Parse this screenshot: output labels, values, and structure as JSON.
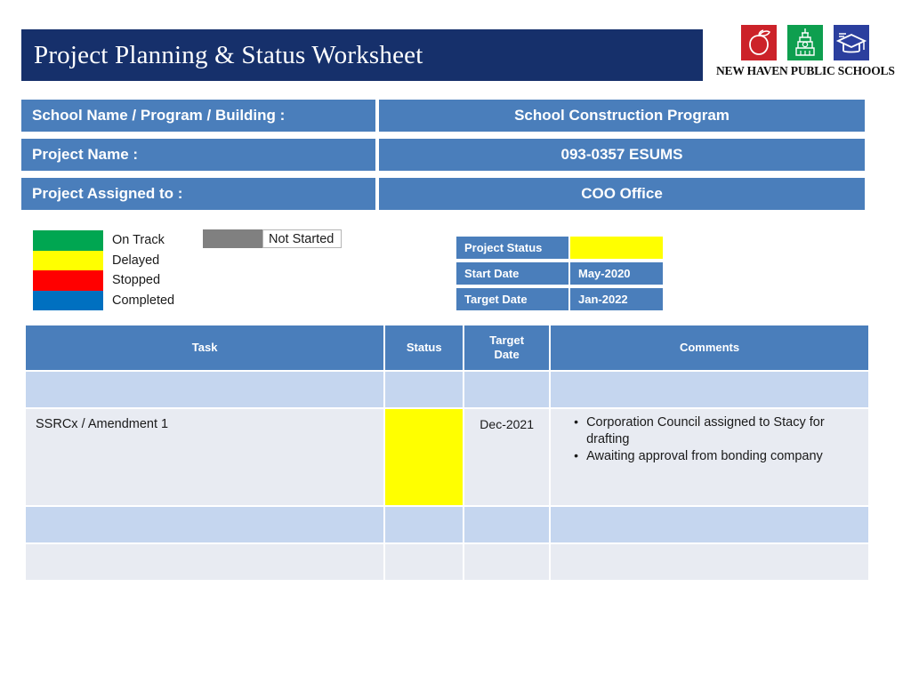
{
  "header": {
    "title": "Project Planning & Status Worksheet",
    "logo": {
      "name": "new-haven-public-schools-logo",
      "wordmark": "NEW HAVEN PUBLIC SCHOOLS",
      "marks": [
        {
          "icon": "apple-icon",
          "color": "#cc2229"
        },
        {
          "icon": "tower-icon",
          "color": "#0e9f4f"
        },
        {
          "icon": "graduation-cap-icon",
          "color": "#2b3f9e"
        }
      ]
    }
  },
  "info_rows": [
    {
      "label": "School Name / Program / Building :",
      "value": "School Construction Program"
    },
    {
      "label": "Project Name :",
      "value": "093-0357 ESUMS"
    },
    {
      "label": "Project Assigned to :",
      "value": "COO Office"
    }
  ],
  "legend": {
    "items": [
      {
        "label": "On Track",
        "color": "#00a651"
      },
      {
        "label": "Delayed",
        "color": "#ffff00"
      },
      {
        "label": "Stopped",
        "color": "#ff0000"
      },
      {
        "label": "Completed",
        "color": "#0070c0"
      }
    ],
    "not_started": {
      "label": "Not Started",
      "color": "#808080"
    }
  },
  "status_panel": {
    "rows": [
      {
        "key": "Project Status",
        "value": "",
        "highlight": "#ffff00"
      },
      {
        "key": "Start Date",
        "value": "May-2020",
        "highlight": ""
      },
      {
        "key": "Target  Date",
        "value": "Jan-2022",
        "highlight": ""
      }
    ]
  },
  "task_table": {
    "columns": [
      "Task",
      "Status",
      "Target\nDate",
      "Comments"
    ],
    "column_labels": {
      "task": "Task",
      "status": "Status",
      "target_date_line1": "Target",
      "target_date_line2": "Date",
      "comments": "Comments"
    },
    "rows": [
      {
        "task": "",
        "status_color": "",
        "target_date": "",
        "comments": []
      },
      {
        "task": "SSRCx / Amendment 1",
        "status_color": "#ffff00",
        "target_date": "Dec-2021",
        "comments": [
          "Corporation Council assigned to Stacy for drafting",
          "Awaiting approval from bonding company"
        ]
      },
      {
        "task": "",
        "status_color": "",
        "target_date": "",
        "comments": []
      },
      {
        "task": "",
        "status_color": "",
        "target_date": "",
        "comments": []
      }
    ]
  }
}
